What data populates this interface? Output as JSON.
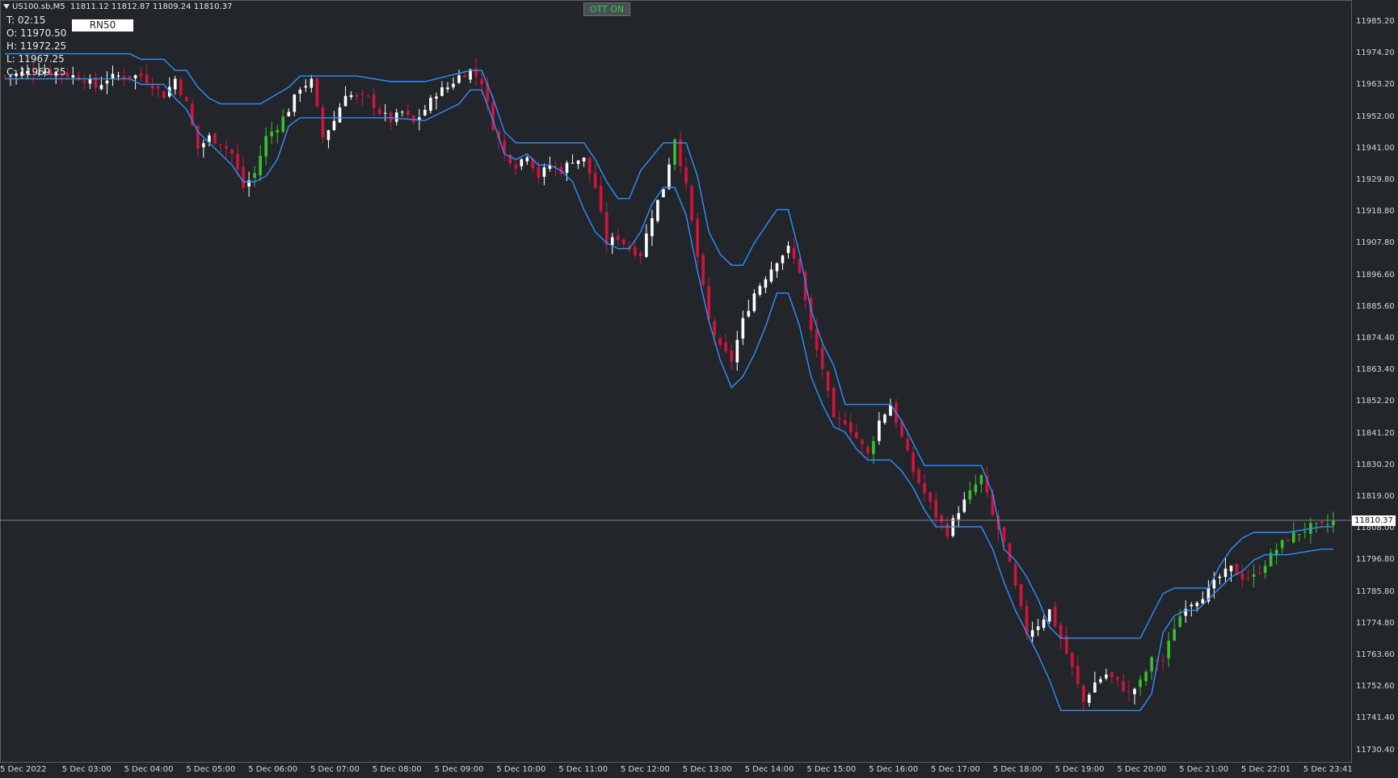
{
  "header": {
    "symbol": "US100.sb,M5",
    "ohlc": "11811.12 11812.87 11809.24 11810.37"
  },
  "info_panel": {
    "time": "T: 02:15",
    "open": "O: 11970.50",
    "high": "H: 11972.25",
    "low": "L: 11967.25",
    "close": "C: 11969.25",
    "rn_label": "RN50"
  },
  "indicator": {
    "ott_status": "OTT ON",
    "status_color": "#2ecc40"
  },
  "current_price": "11810.37",
  "colors": {
    "background": "#22262b",
    "bull_candle": "#ffffff",
    "bear_candle": "#d2143c",
    "trend_candle": "#3bbf2f",
    "ott_line": "#2f8fff"
  },
  "chart_data": {
    "type": "candlestick",
    "ylim": [
      11725,
      11995
    ],
    "y_ticks": [
      "11985.20",
      "11974.20",
      "11963.20",
      "11952.00",
      "11941.00",
      "11929.80",
      "11918.80",
      "11907.80",
      "11896.60",
      "11885.60",
      "11874.40",
      "11863.40",
      "11852.20",
      "11841.20",
      "11830.20",
      "11819.00",
      "11808.00",
      "11796.80",
      "11785.80",
      "11774.80",
      "11763.60",
      "11752.60",
      "11741.40",
      "11730.40"
    ],
    "x_ticks": [
      "5 Dec 2022",
      "5 Dec 03:00",
      "5 Dec 04:00",
      "5 Dec 05:00",
      "5 Dec 06:00",
      "5 Dec 07:00",
      "5 Dec 08:00",
      "5 Dec 09:00",
      "5 Dec 10:00",
      "5 Dec 11:00",
      "5 Dec 12:00",
      "5 Dec 13:00",
      "5 Dec 14:00",
      "5 Dec 15:00",
      "5 Dec 16:00",
      "5 Dec 17:00",
      "5 Dec 18:00",
      "5 Dec 19:00",
      "5 Dec 20:00",
      "5 Dec 21:00",
      "5 Dec 22:01",
      "5 Dec 23:41"
    ],
    "close_path": [
      [
        0,
        11970
      ],
      [
        6,
        11972
      ],
      [
        10,
        11971
      ],
      [
        14,
        11969
      ],
      [
        16,
        11966
      ],
      [
        18,
        11969
      ],
      [
        20,
        11970
      ],
      [
        22,
        11970
      ],
      [
        24,
        11970
      ],
      [
        26,
        11967
      ],
      [
        28,
        11963
      ],
      [
        30,
        11969
      ],
      [
        32,
        11960
      ],
      [
        34,
        11944
      ],
      [
        36,
        11948
      ],
      [
        38,
        11946
      ],
      [
        40,
        11942
      ],
      [
        42,
        11930
      ],
      [
        44,
        11935
      ],
      [
        46,
        11948
      ],
      [
        48,
        11952
      ],
      [
        50,
        11958
      ],
      [
        52,
        11966
      ],
      [
        54,
        11968
      ],
      [
        56,
        11948
      ],
      [
        58,
        11954
      ],
      [
        60,
        11964
      ],
      [
        62,
        11962
      ],
      [
        64,
        11962
      ],
      [
        66,
        11957
      ],
      [
        68,
        11954
      ],
      [
        70,
        11957
      ],
      [
        72,
        11953
      ],
      [
        74,
        11958
      ],
      [
        76,
        11964
      ],
      [
        78,
        11966
      ],
      [
        80,
        11970
      ],
      [
        82,
        11972
      ],
      [
        84,
        11968
      ],
      [
        86,
        11952
      ],
      [
        88,
        11942
      ],
      [
        90,
        11938
      ],
      [
        92,
        11942
      ],
      [
        94,
        11934
      ],
      [
        96,
        11938
      ],
      [
        98,
        11936
      ],
      [
        100,
        11940
      ],
      [
        102,
        11940
      ],
      [
        104,
        11930
      ],
      [
        106,
        11910
      ],
      [
        108,
        11912
      ],
      [
        110,
        11908
      ],
      [
        112,
        11906
      ],
      [
        114,
        11920
      ],
      [
        116,
        11930
      ],
      [
        118,
        11948
      ],
      [
        120,
        11930
      ],
      [
        122,
        11905
      ],
      [
        124,
        11882
      ],
      [
        126,
        11872
      ],
      [
        128,
        11868
      ],
      [
        130,
        11882
      ],
      [
        132,
        11892
      ],
      [
        134,
        11898
      ],
      [
        136,
        11904
      ],
      [
        138,
        11908
      ],
      [
        140,
        11900
      ],
      [
        142,
        11878
      ],
      [
        144,
        11865
      ],
      [
        146,
        11846
      ],
      [
        148,
        11846
      ],
      [
        150,
        11840
      ],
      [
        152,
        11834
      ],
      [
        154,
        11846
      ],
      [
        156,
        11852
      ],
      [
        158,
        11840
      ],
      [
        160,
        11828
      ],
      [
        162,
        11820
      ],
      [
        164,
        11812
      ],
      [
        166,
        11806
      ],
      [
        168,
        11814
      ],
      [
        170,
        11820
      ],
      [
        172,
        11826
      ],
      [
        174,
        11812
      ],
      [
        176,
        11802
      ],
      [
        178,
        11786
      ],
      [
        180,
        11770
      ],
      [
        182,
        11773
      ],
      [
        184,
        11778
      ],
      [
        186,
        11768
      ],
      [
        188,
        11757
      ],
      [
        190,
        11745
      ],
      [
        192,
        11752
      ],
      [
        194,
        11755
      ],
      [
        196,
        11752
      ],
      [
        198,
        11748
      ],
      [
        200,
        11752
      ],
      [
        202,
        11760
      ],
      [
        204,
        11760
      ],
      [
        206,
        11772
      ],
      [
        208,
        11780
      ],
      [
        210,
        11782
      ],
      [
        212,
        11785
      ],
      [
        214,
        11790
      ],
      [
        216,
        11793
      ],
      [
        218,
        11790
      ],
      [
        220,
        11790
      ],
      [
        222,
        11795
      ],
      [
        224,
        11800
      ],
      [
        226,
        11804
      ],
      [
        228,
        11806
      ],
      [
        230,
        11808
      ],
      [
        232,
        11808
      ],
      [
        234,
        11810
      ]
    ],
    "ott_upper": [
      [
        0,
        11978
      ],
      [
        22,
        11978
      ],
      [
        24,
        11976
      ],
      [
        28,
        11976
      ],
      [
        30,
        11972
      ],
      [
        32,
        11972
      ],
      [
        34,
        11966
      ],
      [
        36,
        11962
      ],
      [
        38,
        11960
      ],
      [
        45,
        11960
      ],
      [
        50,
        11966
      ],
      [
        52,
        11970
      ],
      [
        62,
        11970
      ],
      [
        68,
        11968
      ],
      [
        74,
        11968
      ],
      [
        78,
        11970
      ],
      [
        82,
        11972
      ],
      [
        84,
        11972
      ],
      [
        86,
        11962
      ],
      [
        88,
        11950
      ],
      [
        90,
        11946
      ],
      [
        98,
        11946
      ],
      [
        102,
        11946
      ],
      [
        104,
        11940
      ],
      [
        106,
        11932
      ],
      [
        108,
        11926
      ],
      [
        110,
        11926
      ],
      [
        112,
        11936
      ],
      [
        116,
        11946
      ],
      [
        118,
        11946
      ],
      [
        120,
        11946
      ],
      [
        122,
        11934
      ],
      [
        124,
        11914
      ],
      [
        126,
        11906
      ],
      [
        128,
        11902
      ],
      [
        130,
        11902
      ],
      [
        132,
        11910
      ],
      [
        134,
        11916
      ],
      [
        136,
        11922
      ],
      [
        138,
        11922
      ],
      [
        140,
        11906
      ],
      [
        142,
        11886
      ],
      [
        144,
        11874
      ],
      [
        146,
        11866
      ],
      [
        148,
        11852
      ],
      [
        150,
        11852
      ],
      [
        154,
        11852
      ],
      [
        156,
        11852
      ],
      [
        158,
        11846
      ],
      [
        160,
        11838
      ],
      [
        162,
        11830
      ],
      [
        166,
        11830
      ],
      [
        168,
        11830
      ],
      [
        170,
        11830
      ],
      [
        172,
        11830
      ],
      [
        174,
        11820
      ],
      [
        176,
        11800
      ],
      [
        178,
        11796
      ],
      [
        180,
        11790
      ],
      [
        182,
        11782
      ],
      [
        184,
        11772
      ],
      [
        186,
        11768
      ],
      [
        188,
        11768
      ],
      [
        190,
        11768
      ],
      [
        200,
        11768
      ],
      [
        202,
        11776
      ],
      [
        204,
        11784
      ],
      [
        206,
        11786
      ],
      [
        208,
        11786
      ],
      [
        210,
        11786
      ],
      [
        212,
        11786
      ],
      [
        214,
        11794
      ],
      [
        216,
        11800
      ],
      [
        218,
        11804
      ],
      [
        220,
        11806
      ],
      [
        222,
        11806
      ],
      [
        226,
        11806
      ],
      [
        232,
        11808
      ],
      [
        234,
        11808
      ]
    ],
    "ott_lower": [
      [
        0,
        11969
      ],
      [
        22,
        11969
      ],
      [
        24,
        11967
      ],
      [
        28,
        11967
      ],
      [
        30,
        11962
      ],
      [
        32,
        11958
      ],
      [
        34,
        11950
      ],
      [
        36,
        11946
      ],
      [
        38,
        11942
      ],
      [
        40,
        11938
      ],
      [
        42,
        11932
      ],
      [
        44,
        11932
      ],
      [
        46,
        11934
      ],
      [
        48,
        11940
      ],
      [
        50,
        11952
      ],
      [
        52,
        11955
      ],
      [
        62,
        11955
      ],
      [
        68,
        11955
      ],
      [
        74,
        11954
      ],
      [
        78,
        11958
      ],
      [
        80,
        11960
      ],
      [
        82,
        11965
      ],
      [
        84,
        11965
      ],
      [
        86,
        11954
      ],
      [
        88,
        11942
      ],
      [
        90,
        11940
      ],
      [
        92,
        11942
      ],
      [
        94,
        11938
      ],
      [
        96,
        11938
      ],
      [
        98,
        11936
      ],
      [
        100,
        11932
      ],
      [
        102,
        11922
      ],
      [
        104,
        11914
      ],
      [
        106,
        11910
      ],
      [
        108,
        11908
      ],
      [
        110,
        11908
      ],
      [
        112,
        11914
      ],
      [
        114,
        11924
      ],
      [
        116,
        11930
      ],
      [
        118,
        11930
      ],
      [
        120,
        11920
      ],
      [
        122,
        11900
      ],
      [
        124,
        11882
      ],
      [
        126,
        11868
      ],
      [
        128,
        11858
      ],
      [
        130,
        11862
      ],
      [
        132,
        11870
      ],
      [
        134,
        11880
      ],
      [
        136,
        11892
      ],
      [
        138,
        11892
      ],
      [
        140,
        11880
      ],
      [
        142,
        11862
      ],
      [
        144,
        11852
      ],
      [
        146,
        11844
      ],
      [
        148,
        11842
      ],
      [
        150,
        11836
      ],
      [
        152,
        11832
      ],
      [
        154,
        11832
      ],
      [
        156,
        11832
      ],
      [
        158,
        11828
      ],
      [
        160,
        11822
      ],
      [
        162,
        11814
      ],
      [
        164,
        11808
      ],
      [
        168,
        11808
      ],
      [
        170,
        11808
      ],
      [
        172,
        11808
      ],
      [
        174,
        11800
      ],
      [
        176,
        11788
      ],
      [
        178,
        11778
      ],
      [
        180,
        11770
      ],
      [
        182,
        11762
      ],
      [
        184,
        11753
      ],
      [
        186,
        11742
      ],
      [
        188,
        11742
      ],
      [
        190,
        11742
      ],
      [
        200,
        11742
      ],
      [
        202,
        11748
      ],
      [
        204,
        11770
      ],
      [
        206,
        11776
      ],
      [
        208,
        11778
      ],
      [
        210,
        11778
      ],
      [
        212,
        11782
      ],
      [
        214,
        11786
      ],
      [
        216,
        11790
      ],
      [
        218,
        11792
      ],
      [
        220,
        11796
      ],
      [
        222,
        11798
      ],
      [
        226,
        11798
      ],
      [
        232,
        11800
      ],
      [
        234,
        11800
      ]
    ],
    "trend_segments": [
      [
        44,
        49
      ],
      [
        85,
        88
      ],
      [
        118,
        122
      ],
      [
        146,
        153
      ],
      [
        170,
        176
      ],
      [
        200,
        207
      ],
      [
        218,
        234
      ]
    ]
  }
}
